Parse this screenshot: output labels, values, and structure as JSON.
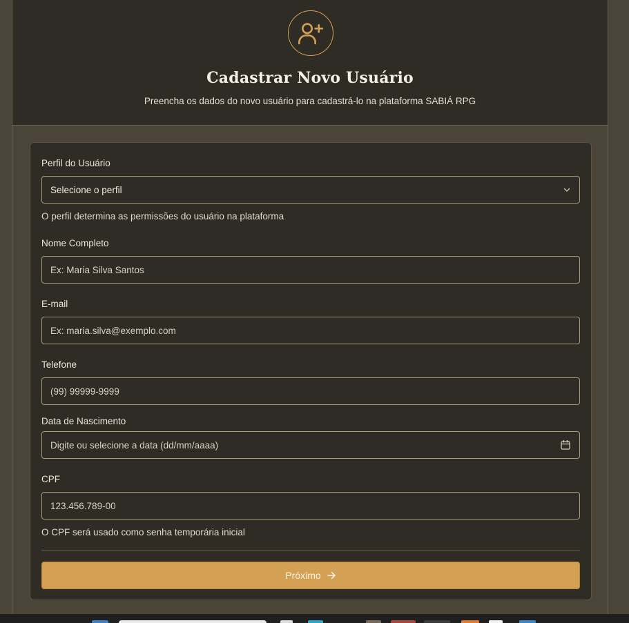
{
  "header": {
    "icon": "user-plus-icon",
    "title": "Cadastrar Novo Usuário",
    "subtitle": "Preencha os dados do novo usuário para cadastrá-lo na plataforma SABIÁ RPG"
  },
  "form": {
    "profile": {
      "label": "Perfil do Usuário",
      "selected": "Selecione o perfil",
      "helper": "O perfil determina as permissões do usuário na plataforma"
    },
    "name": {
      "label": "Nome Completo",
      "placeholder": "Ex: Maria Silva Santos"
    },
    "email": {
      "label": "E-mail",
      "placeholder": "Ex: maria.silva@exemplo.com"
    },
    "phone": {
      "label": "Telefone",
      "placeholder": "(99) 99999-9999"
    },
    "birthdate": {
      "label": "Data de Nascimento",
      "placeholder": "Digite ou selecione a data (dd/mm/aaaa)"
    },
    "cpf": {
      "label": "CPF",
      "placeholder": "123.456.789-00",
      "helper": "O CPF será usado como senha temporária inicial"
    },
    "next_label": "Próximo"
  },
  "colors": {
    "accent": "#d4a053",
    "background": "#2f2c25",
    "surround": "#4a4538"
  }
}
